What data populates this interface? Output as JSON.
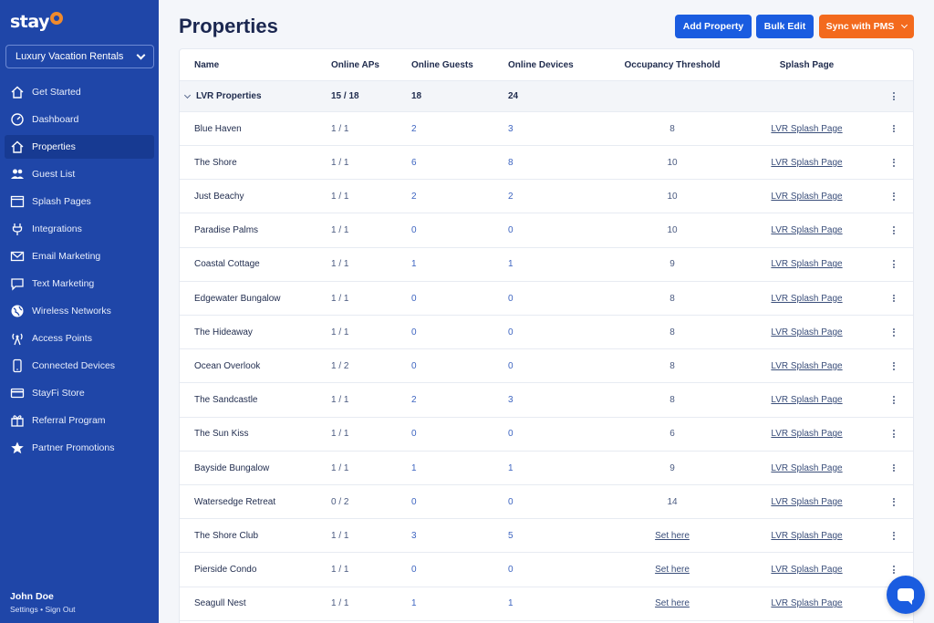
{
  "app": {
    "logo_text": "stay",
    "logo_icon": "wifi-dot-icon"
  },
  "account": {
    "selected": "Luxury Vacation Rentals"
  },
  "nav": [
    {
      "label": "Get Started",
      "icon": "house-icon"
    },
    {
      "label": "Dashboard",
      "icon": "gauge-icon"
    },
    {
      "label": "Properties",
      "icon": "house-icon",
      "active": true
    },
    {
      "label": "Guest List",
      "icon": "users-icon"
    },
    {
      "label": "Splash Pages",
      "icon": "browser-window-icon"
    },
    {
      "label": "Integrations",
      "icon": "plug-icon"
    },
    {
      "label": "Email Marketing",
      "icon": "envelope-icon"
    },
    {
      "label": "Text Marketing",
      "icon": "chat-icon"
    },
    {
      "label": "Wireless Networks",
      "icon": "globe-icon"
    },
    {
      "label": "Access Points",
      "icon": "antenna-icon"
    },
    {
      "label": "Connected Devices",
      "icon": "phone-icon"
    },
    {
      "label": "StayFi Store",
      "icon": "card-icon"
    },
    {
      "label": "Referral Program",
      "icon": "gift-icon"
    },
    {
      "label": "Partner Promotions",
      "icon": "star-icon"
    }
  ],
  "user": {
    "name": "John Doe",
    "settings": "Settings",
    "separator": "•",
    "signout": "Sign Out"
  },
  "header": {
    "title": "Properties",
    "add_label": "Add Property",
    "bulk_label": "Bulk Edit",
    "sync_label": "Sync with PMS"
  },
  "table": {
    "columns": [
      "Name",
      "Online APs",
      "Online Guests",
      "Online Devices",
      "Occupancy Threshold",
      "Splash Page"
    ],
    "group": {
      "name": "LVR Properties",
      "aps": "15 / 18",
      "guests": "18",
      "devices": "24"
    },
    "rows": [
      {
        "name": "Blue Haven",
        "aps": "1 / 1",
        "guests": "2",
        "devices": "3",
        "threshold": "8",
        "splash": "LVR Splash Page"
      },
      {
        "name": "The Shore",
        "aps": "1 / 1",
        "guests": "6",
        "devices": "8",
        "threshold": "10",
        "splash": "LVR Splash Page"
      },
      {
        "name": "Just Beachy",
        "aps": "1 / 1",
        "guests": "2",
        "devices": "2",
        "threshold": "10",
        "splash": "LVR Splash Page"
      },
      {
        "name": "Paradise Palms",
        "aps": "1 / 1",
        "guests": "0",
        "devices": "0",
        "threshold": "10",
        "splash": "LVR Splash Page"
      },
      {
        "name": "Coastal Cottage",
        "aps": "1 / 1",
        "guests": "1",
        "devices": "1",
        "threshold": "9",
        "splash": "LVR Splash Page"
      },
      {
        "name": "Edgewater Bungalow",
        "aps": "1 / 1",
        "guests": "0",
        "devices": "0",
        "threshold": "8",
        "splash": "LVR Splash Page"
      },
      {
        "name": "The Hideaway",
        "aps": "1 / 1",
        "guests": "0",
        "devices": "0",
        "threshold": "8",
        "splash": "LVR Splash Page"
      },
      {
        "name": "Ocean Overlook",
        "aps": "1 / 2",
        "guests": "0",
        "devices": "0",
        "threshold": "8",
        "splash": "LVR Splash Page"
      },
      {
        "name": "The Sandcastle",
        "aps": "1 / 1",
        "guests": "2",
        "devices": "3",
        "threshold": "8",
        "splash": "LVR Splash Page"
      },
      {
        "name": "The Sun Kiss",
        "aps": "1 / 1",
        "guests": "0",
        "devices": "0",
        "threshold": "6",
        "splash": "LVR Splash Page"
      },
      {
        "name": "Bayside Bungalow",
        "aps": "1 / 1",
        "guests": "1",
        "devices": "1",
        "threshold": "9",
        "splash": "LVR Splash Page"
      },
      {
        "name": "Watersedge Retreat",
        "aps": "0 / 2",
        "guests": "0",
        "devices": "0",
        "threshold": "14",
        "splash": "LVR Splash Page"
      },
      {
        "name": "The Shore Club",
        "aps": "1 / 1",
        "guests": "3",
        "devices": "5",
        "threshold": "Set here",
        "threshold_is_link": true,
        "splash": "LVR Splash Page"
      },
      {
        "name": "Pierside Condo",
        "aps": "1 / 1",
        "guests": "0",
        "devices": "0",
        "threshold": "Set here",
        "threshold_is_link": true,
        "splash": "LVR Splash Page"
      },
      {
        "name": "Seagull Nest",
        "aps": "1 / 1",
        "guests": "1",
        "devices": "1",
        "threshold": "Set here",
        "threshold_is_link": true,
        "splash": "LVR Splash Page"
      }
    ]
  },
  "colors": {
    "sidebar": "#1f46a8",
    "sidebar_active": "#173a92",
    "primary": "#1a5ce0",
    "accent": "#f36a1d",
    "logo_accent": "#f08a2c"
  },
  "chat": {
    "icon": "chat-bubble-icon"
  }
}
